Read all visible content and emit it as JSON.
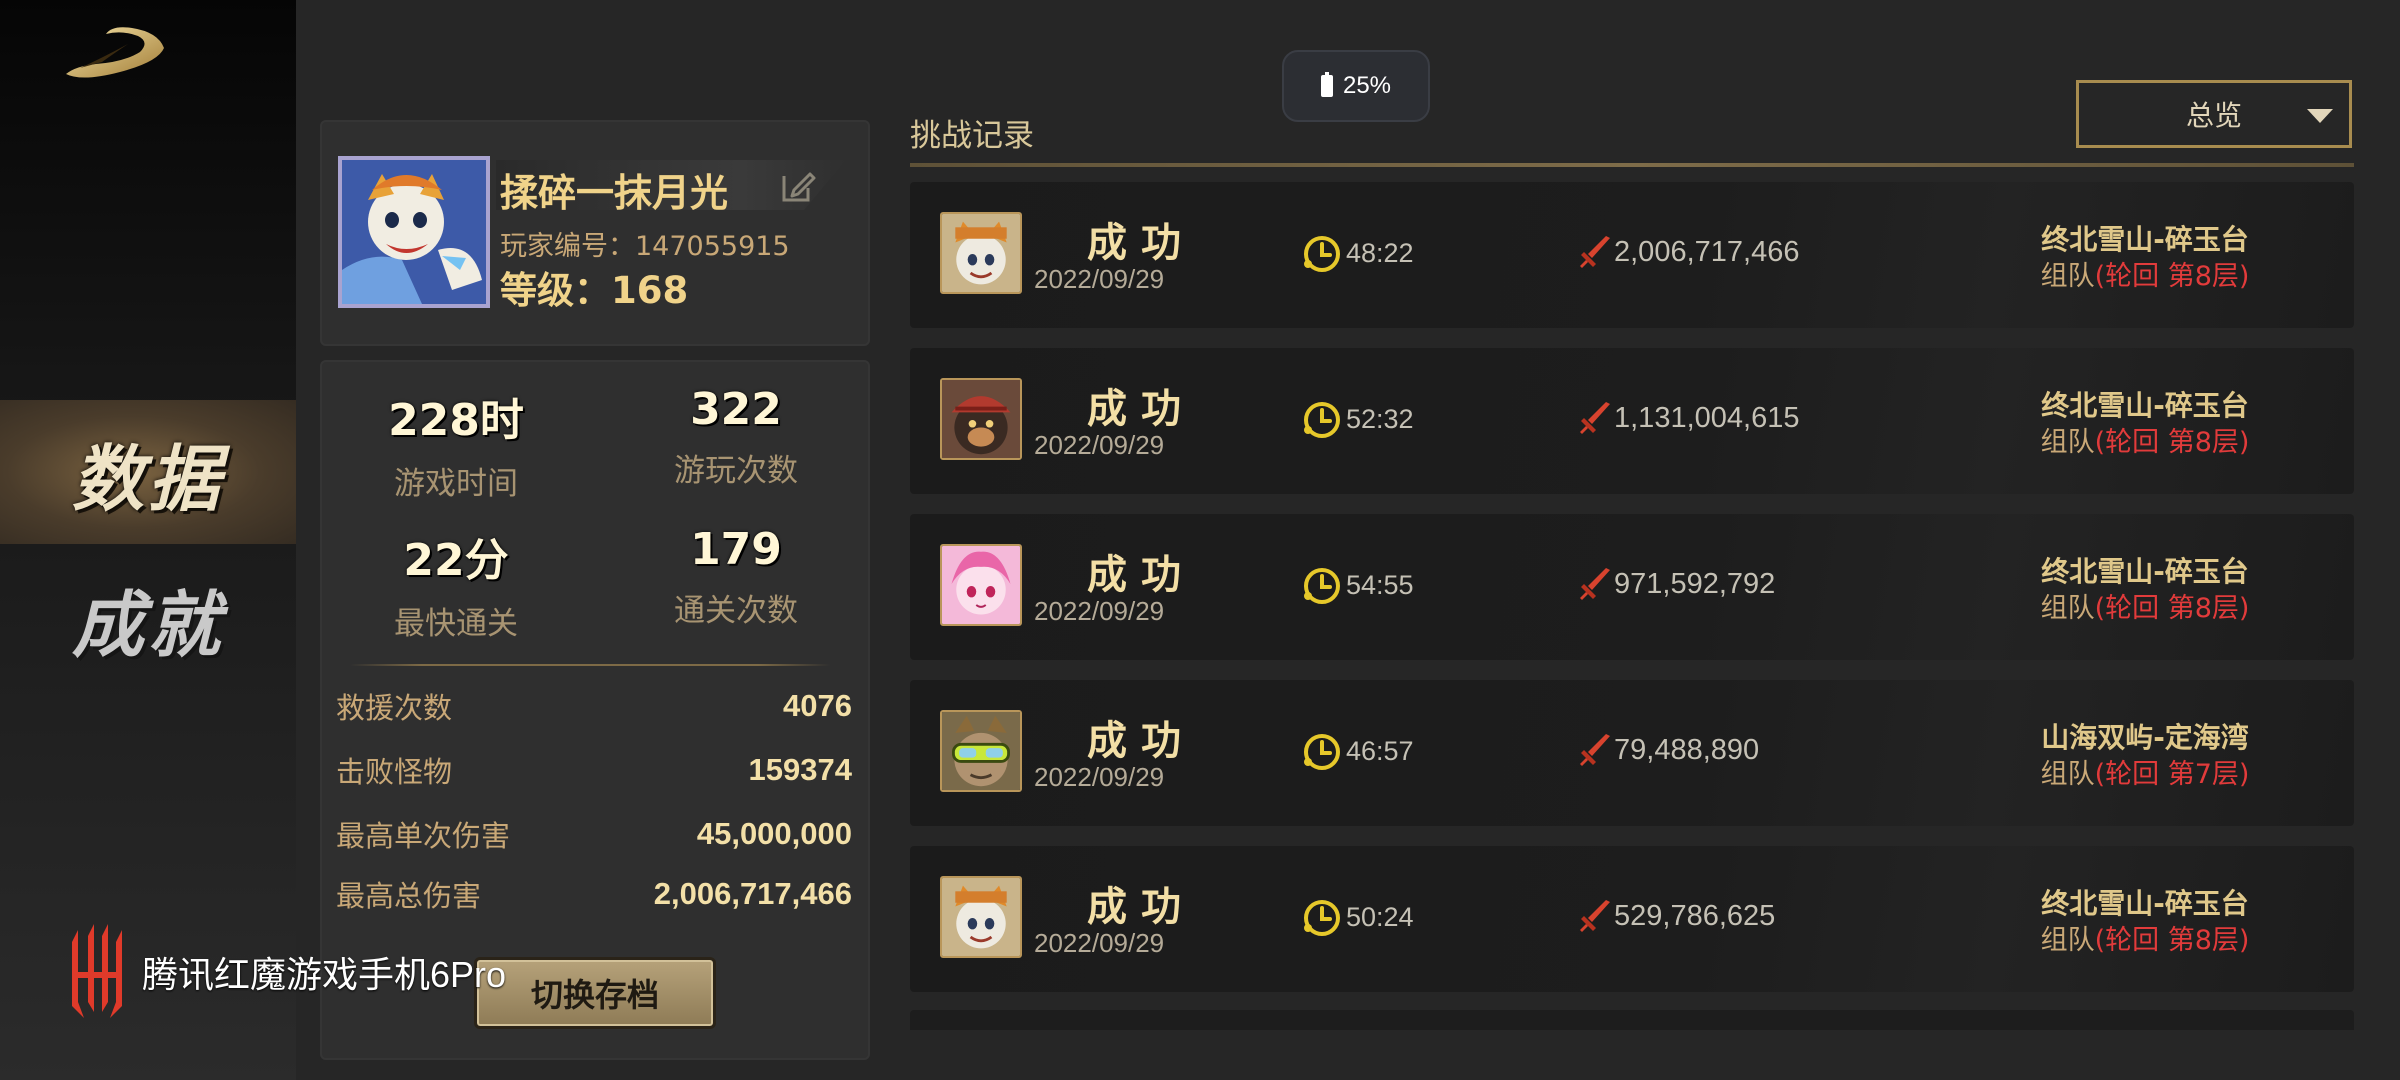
{
  "nav": {
    "items": [
      {
        "label": "数据",
        "active": true
      },
      {
        "label": "成就",
        "active": false
      }
    ]
  },
  "watermark": {
    "text": "腾讯红魔游戏手机6Pro"
  },
  "status": {
    "battery": "25%"
  },
  "profile": {
    "name": "揉碎一抹月光",
    "id_label": "玩家编号：",
    "id_value": "147055915",
    "level_label": "等级：",
    "level_value": "168"
  },
  "stats": {
    "big": [
      {
        "value": "228时",
        "label": "游戏时间"
      },
      {
        "value": "322",
        "label": "游玩次数"
      },
      {
        "value": "22分",
        "label": "最快通关"
      },
      {
        "value": "179",
        "label": "通关次数"
      }
    ],
    "rows": [
      {
        "label": "救援次数",
        "value": "4076"
      },
      {
        "label": "击败怪物",
        "value": "159374"
      },
      {
        "label": "最高单次伤害",
        "value": "45,000,000"
      },
      {
        "label": "最高总伤害",
        "value": "2,006,717,466"
      }
    ],
    "switch_label": "切换存档"
  },
  "records": {
    "title": "挑战记录",
    "filter": "总览",
    "items": [
      {
        "hero_icon": "cat-hero-portrait",
        "result": "成功",
        "date": "2022/09/29",
        "time": "48:22",
        "damage": "2,006,717,466",
        "location": "终北雪山-碎玉台",
        "mode_prefix": "组队",
        "mode_detail": "(轮回  第8层)"
      },
      {
        "hero_icon": "bear-hero-portrait",
        "result": "成功",
        "date": "2022/09/29",
        "time": "52:32",
        "damage": "1,131,004,615",
        "location": "终北雪山-碎玉台",
        "mode_prefix": "组队",
        "mode_detail": "(轮回  第8层)"
      },
      {
        "hero_icon": "pink-girl-portrait",
        "result": "成功",
        "date": "2022/09/29",
        "time": "54:55",
        "damage": "971,592,792",
        "location": "终北雪山-碎玉台",
        "mode_prefix": "组队",
        "mode_detail": "(轮回  第8层)"
      },
      {
        "hero_icon": "goggles-hero-portrait",
        "result": "成功",
        "date": "2022/09/29",
        "time": "46:57",
        "damage": "79,488,890",
        "location": "山海双屿-定海湾",
        "mode_prefix": "组队",
        "mode_detail": "(轮回  第7层)"
      },
      {
        "hero_icon": "cat-hero-portrait",
        "result": "成功",
        "date": "2022/09/29",
        "time": "50:24",
        "damage": "529,786,625",
        "location": "终北雪山-碎玉台",
        "mode_prefix": "组队",
        "mode_detail": "(轮回  第8层)"
      }
    ]
  },
  "colors": {
    "gold": "#f0d38a",
    "accent_red": "#e23b3b",
    "panel_bg": "#2f2f2f",
    "card_bg": "#1c1c1c"
  }
}
